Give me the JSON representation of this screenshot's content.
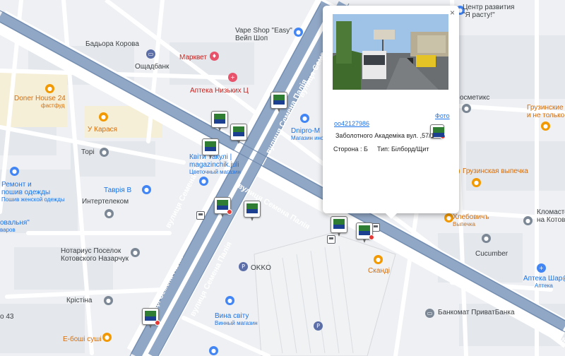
{
  "colors": {
    "background": "#eef0f3",
    "block": "#e3e6eb",
    "road": "#ffffff",
    "highway": "#8fa6c4",
    "highway_dark": "#6f89ad",
    "orange_poi": "#f29900",
    "blue_poi": "#4285f4",
    "link": "#1a73e8"
  },
  "streets": {
    "main_1": "вулиця Семена Палія",
    "main_2": "вулиця Семена Палія",
    "main_3": "вулиця Семена Палія",
    "main_4": "вулиця Семена Палія",
    "right": "вулиця Семена Палія",
    "top": "вулиця Семе"
  },
  "pois": {
    "vape_shop": {
      "name": "Vape Shop \"Easy\"",
      "sub": "Вейп Шоп",
      "icon": "shopping-bag-icon"
    },
    "badora": {
      "name": "Бадьора Корова"
    },
    "oschadbank": {
      "name": "Ощадбанк",
      "icon": "bank-icon"
    },
    "markvet": {
      "name": "Марквет",
      "icon": "pet-store-icon"
    },
    "apteka": {
      "name": "Аптека Низьких Ц",
      "icon": "pharmacy-icon"
    },
    "doner": {
      "name": "Doner House 24",
      "sub": "фастфуд",
      "icon": "fastfood-icon"
    },
    "u_karasya": {
      "name": "У Карася",
      "icon": "restaurant-icon"
    },
    "tori": {
      "name": "Торі",
      "icon": "place-icon"
    },
    "kvity": {
      "name": "Квіти Такулі |",
      "name2": "magazinchik.juli",
      "sub": "Цветочный магазин",
      "icon": "flower-icon"
    },
    "dnipro": {
      "name": "Dnipro-M",
      "sub": "Магазин инс",
      "icon": "tool-store-icon"
    },
    "remont": {
      "name": "Ремонт и",
      "name2": "пошив одежды",
      "sub": "Пошив женской одежды",
      "icon": "sewing-icon"
    },
    "tavria": {
      "name": "Таврія В",
      "icon": "cart-icon"
    },
    "intertelekom": {
      "name": "Интертелеком",
      "icon": "place-icon"
    },
    "rovalnya": {
      "name": "овальня\"",
      "sub": "варов"
    },
    "notarius": {
      "name": "Нотариус Поселок",
      "name2": "Котовского Назарчук",
      "icon": "place-icon"
    },
    "okko": {
      "name": "OKKO",
      "icon": "gas-station-icon"
    },
    "kristina": {
      "name": "Крістіна",
      "icon": "place-icon"
    },
    "vina": {
      "name": "Вина світу",
      "sub": "Винный магазин",
      "icon": "wine-icon"
    },
    "eboshi": {
      "name": "Е-боші суші",
      "icon": "restaurant-icon"
    },
    "skandi": {
      "name": "Сканді",
      "icon": "restaurant-icon"
    },
    "kosmetiks": {
      "name": "осметикс"
    },
    "gruzinskie": {
      "name": "Грузинские",
      "name2": "и не только",
      "icon": "restaurant-icon"
    },
    "gruz_vypechka": {
      "name": "Грузинская выпечка",
      "icon": "bakery-icon"
    },
    "hlebovich": {
      "name": "Хлебовичъ",
      "sub": "Выпечка",
      "icon": "bakery-icon"
    },
    "klomaster": {
      "name": "Кломастер",
      "name2": "на Котовськ",
      "icon": "place-icon"
    },
    "cucumber": {
      "name": "Cucumber",
      "icon": "place-icon"
    },
    "apteka_shar": {
      "name": "Аптека Шар@",
      "sub": "Аптека",
      "icon": "pharmacy-icon"
    },
    "bankomat": {
      "name": "Банкомат ПриватБанка",
      "icon": "atm-icon"
    },
    "dom43": {
      "name": "о 43"
    },
    "center_razv": {
      "name": "Центр развития",
      "name2": "\"Я расту!\"",
      "icon": "education-icon"
    },
    "parking": {
      "name": "P",
      "icon": "parking-icon"
    },
    "parking2": {
      "name": "P",
      "icon": "parking-icon"
    }
  },
  "popup": {
    "close": "×",
    "photo_link": "Фото",
    "id": "oo42127986",
    "address": "Заболотного Академіка вул. ,57/1",
    "side": "Сторона : Б",
    "type": "Тип: Білборд/Щит"
  }
}
